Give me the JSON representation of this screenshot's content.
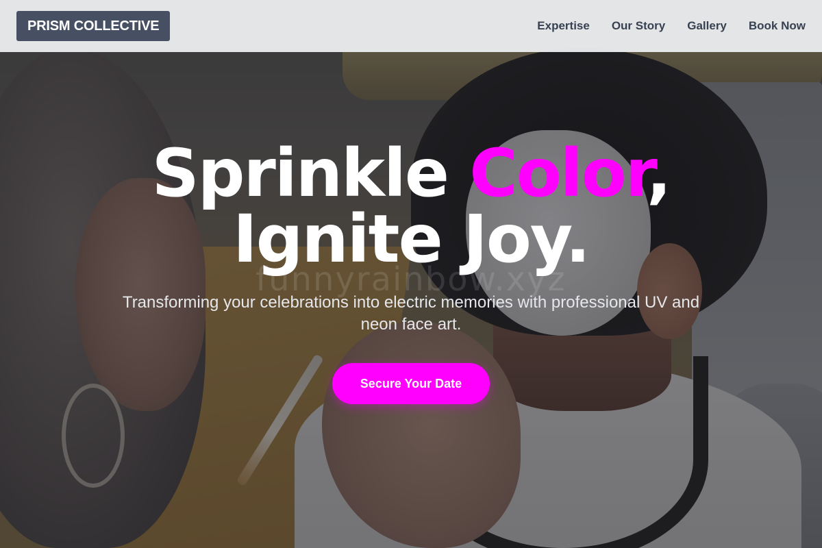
{
  "header": {
    "brand": "PRISM COLLECTIVE",
    "nav": [
      {
        "label": "Expertise"
      },
      {
        "label": "Our Story"
      },
      {
        "label": "Gallery"
      },
      {
        "label": "Book Now"
      }
    ]
  },
  "hero": {
    "headline_part1": "Sprinkle ",
    "headline_accent": "Color",
    "headline_part2": ",",
    "headline_line2": "Ignite Joy.",
    "watermark": "funnyrainbow.xyz",
    "subtitle": "Transforming your celebrations into electric memories with professional UV and neon face art.",
    "cta_label": "Secure Your Date",
    "image_alt": "Face painter applying white and black face paint to a child's face"
  },
  "colors": {
    "accent": "#ff00ff",
    "brand_bg": "#475062",
    "header_bg": "#f3f4f6",
    "nav_text": "#374151"
  }
}
